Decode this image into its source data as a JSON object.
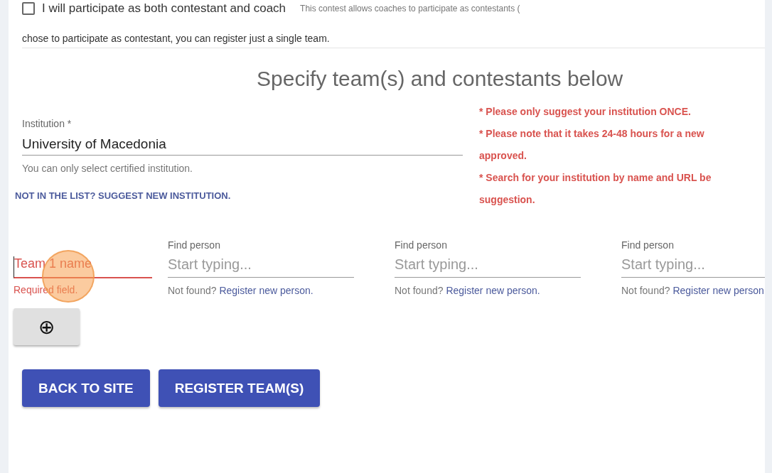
{
  "participation": {
    "checkbox_label": "I will participate as both contestant and coach",
    "checked": false,
    "note": "This contest allows coaches to participate as contestants (",
    "note_continued": "chose to participate as contestant, you can register just a single team."
  },
  "section_title": "Specify team(s) and contestants below",
  "institution": {
    "label": "Institution *",
    "value": "University of Macedonia",
    "hint": "You can only select certified institution.",
    "suggest_link": "NOT IN THE LIST? SUGGEST NEW INSTITUTION."
  },
  "warnings": [
    "* Please only suggest your institution ONCE.",
    "* Please note that it takes 24-48 hours for a new",
    "approved.",
    "* Search for your institution by name and URL be",
    "suggestion."
  ],
  "team": {
    "placeholder": "Team 1 name",
    "error": true,
    "error_text": "Required field."
  },
  "persons": [
    {
      "label": "Find person",
      "placeholder": "Start typing...",
      "hint": "Not found?",
      "link": "Register new person."
    },
    {
      "label": "Find person",
      "placeholder": "Start typing...",
      "hint": "Not found?",
      "link": "Register new person."
    },
    {
      "label": "Find person",
      "placeholder": "Start typing...",
      "hint": "Not found?",
      "link": "Register new person."
    }
  ],
  "add_button": {
    "icon": "⊕"
  },
  "buttons": [
    "BACK TO SITE",
    "REGISTER TEAM(S)"
  ]
}
